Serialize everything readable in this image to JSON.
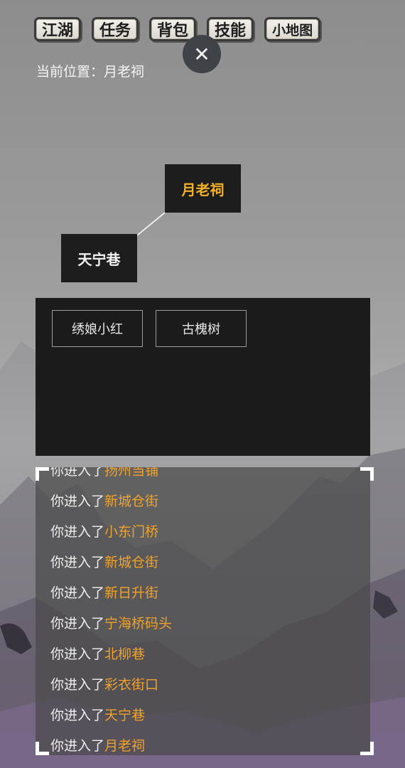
{
  "topbar": {
    "buttons": [
      {
        "label": "江湖"
      },
      {
        "label": "任务"
      },
      {
        "label": "背包"
      },
      {
        "label": "技能"
      },
      {
        "label": "小地图"
      }
    ]
  },
  "close_button": {
    "symbol": "✕"
  },
  "location": {
    "text": "当前位置：月老祠"
  },
  "map": {
    "nodes": [
      {
        "label": "月老祠",
        "current": true
      },
      {
        "label": "天宁巷",
        "current": false
      }
    ],
    "current_color": "#f4b027"
  },
  "npcs": [
    {
      "label": "绣娘小红"
    },
    {
      "label": "古槐树"
    }
  ],
  "log": {
    "prefix": "你进入了",
    "place_color": "#f0a22a",
    "entries": [
      {
        "prefix": "你进入了",
        "place": "扬州当铺"
      },
      {
        "prefix": "你进入了",
        "place": "新城仓街"
      },
      {
        "prefix": "你进入了",
        "place": "小东门桥"
      },
      {
        "prefix": "你进入了",
        "place": "新城仓街"
      },
      {
        "prefix": "你进入了",
        "place": "新日升街"
      },
      {
        "prefix": "你进入了",
        "place": "宁海桥码头"
      },
      {
        "prefix": "你进入了",
        "place": "北柳巷"
      },
      {
        "prefix": "你进入了",
        "place": "彩衣街口"
      },
      {
        "prefix": "你进入了",
        "place": "天宁巷"
      },
      {
        "prefix": "你进入了",
        "place": "月老祠"
      }
    ]
  }
}
